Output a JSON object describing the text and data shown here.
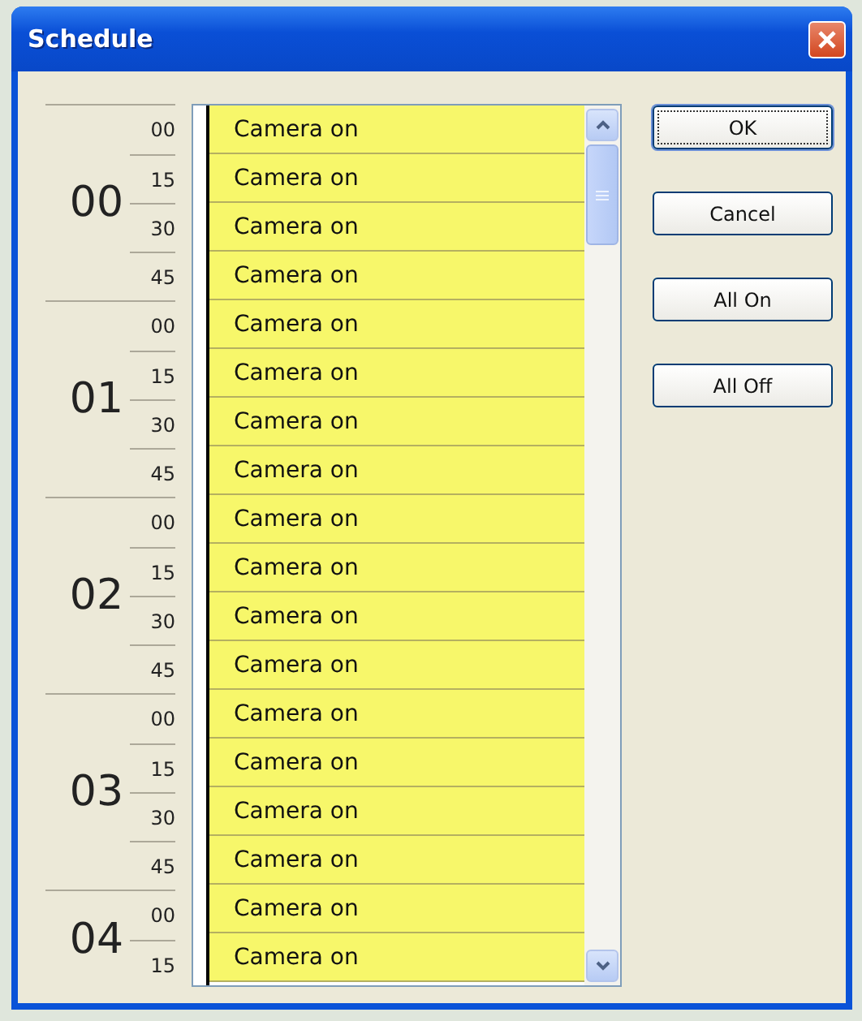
{
  "window": {
    "title": "Schedule"
  },
  "hours": [
    {
      "hour": "00",
      "slots": [
        {
          "minute": "00",
          "label": "Camera on",
          "on": true
        },
        {
          "minute": "15",
          "label": "Camera on",
          "on": true
        },
        {
          "minute": "30",
          "label": "Camera on",
          "on": true
        },
        {
          "minute": "45",
          "label": "Camera on",
          "on": true
        }
      ]
    },
    {
      "hour": "01",
      "slots": [
        {
          "minute": "00",
          "label": "Camera on",
          "on": true
        },
        {
          "minute": "15",
          "label": "Camera on",
          "on": true
        },
        {
          "minute": "30",
          "label": "Camera on",
          "on": true
        },
        {
          "minute": "45",
          "label": "Camera on",
          "on": true
        }
      ]
    },
    {
      "hour": "02",
      "slots": [
        {
          "minute": "00",
          "label": "Camera on",
          "on": true
        },
        {
          "minute": "15",
          "label": "Camera on",
          "on": true
        },
        {
          "minute": "30",
          "label": "Camera on",
          "on": true
        },
        {
          "minute": "45",
          "label": "Camera on",
          "on": true
        }
      ]
    },
    {
      "hour": "03",
      "slots": [
        {
          "minute": "00",
          "label": "Camera on",
          "on": true
        },
        {
          "minute": "15",
          "label": "Camera on",
          "on": true
        },
        {
          "minute": "30",
          "label": "Camera on",
          "on": true
        },
        {
          "minute": "45",
          "label": "Camera on",
          "on": true
        }
      ]
    },
    {
      "hour": "04",
      "slots": [
        {
          "minute": "00",
          "label": "Camera on",
          "on": true
        },
        {
          "minute": "15",
          "label": "Camera on",
          "on": true
        }
      ]
    }
  ],
  "buttons": [
    {
      "label": "OK",
      "default": true
    },
    {
      "label": "Cancel",
      "default": false
    },
    {
      "label": "All On",
      "default": false
    },
    {
      "label": "All Off",
      "default": false
    }
  ]
}
